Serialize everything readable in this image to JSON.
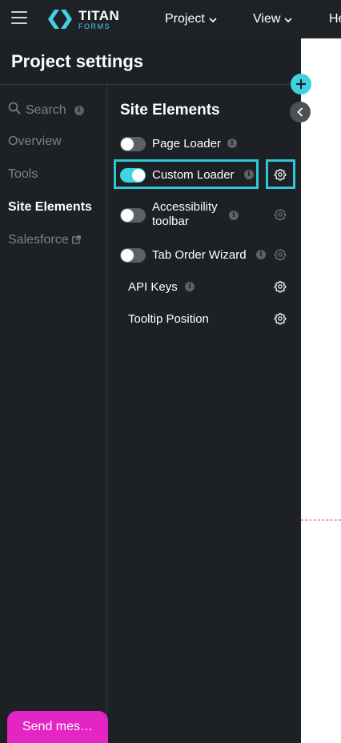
{
  "topbar": {
    "logo_title": "TITAN",
    "logo_subtitle": "FORMS",
    "menu": [
      {
        "label": "Project"
      },
      {
        "label": "View"
      },
      {
        "label": "He"
      }
    ]
  },
  "panel": {
    "title": "Project settings",
    "search_placeholder": "Search",
    "nav": [
      {
        "label": "Overview"
      },
      {
        "label": "Tools"
      },
      {
        "label": "Site Elements"
      },
      {
        "label": "Salesforce"
      }
    ],
    "active_nav": "Site Elements"
  },
  "site_elements": {
    "title": "Site Elements",
    "rows": [
      {
        "label": "Page Loader",
        "toggle": false,
        "has_info": true,
        "has_gear": false
      },
      {
        "label": "Custom Loader",
        "toggle": true,
        "has_info": true,
        "has_gear": true,
        "highlighted": true
      },
      {
        "label_line1": "Accessibility",
        "label_line2": "toolbar",
        "toggle": false,
        "has_info": true,
        "has_gear": true,
        "gear_muted": true
      },
      {
        "label": "Tab Order Wizard",
        "toggle": false,
        "has_info": true,
        "has_gear": true,
        "gear_muted": true
      },
      {
        "label": "API Keys",
        "has_info": true,
        "has_gear": true
      },
      {
        "label": "Tooltip Position",
        "has_gear": true
      }
    ]
  },
  "info_glyph": "i",
  "send_message": {
    "label": "Send mes…"
  },
  "colors": {
    "accent": "#3fd3e0",
    "panel_bg": "#1d2125",
    "topbar_bg": "#1e2227",
    "send_button": "#e524c4"
  }
}
